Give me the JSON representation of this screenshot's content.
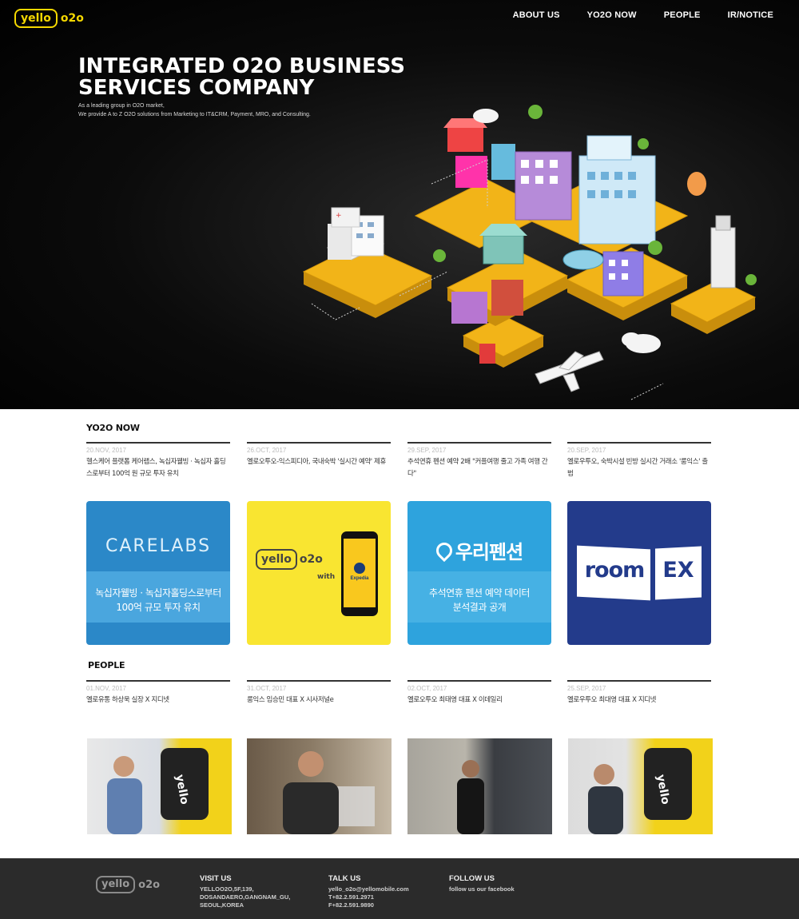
{
  "brand": {
    "logo_word": "yello",
    "logo_suffix": "o2o"
  },
  "nav": [
    {
      "label": "ABOUT US"
    },
    {
      "label": "YO2O NOW"
    },
    {
      "label": "PEOPLE"
    },
    {
      "label": "IR/NOTICE"
    }
  ],
  "hero": {
    "title_line1": "INTEGRATED O2O BUSINESS",
    "title_line2": "SERVICES COMPANY",
    "sub_line1": "As a leading group in O2O market,",
    "sub_line2": "We provide A to Z O2O solutions from Marketing to IT&CRM, Payment, MRO, and Consulting."
  },
  "yo2o_now": {
    "title": "YO2O NOW",
    "items": [
      {
        "date": "20.NOV, 2017",
        "text": "헬스케어 플랫폼 케어랩스, 녹십자웰빙 · 녹십자 홀딩스로부터 100억 원 규모 투자 유치"
      },
      {
        "date": "26.OCT, 2017",
        "text": "옐로오투오-익스피디아, 국내숙박 '실시간 예약' 제휴"
      },
      {
        "date": "29.SEP, 2017",
        "text": "추석연휴 펜션 예약 2배 \"커플여행 줄고 가족 여행 간다\""
      },
      {
        "date": "20.SEP, 2017",
        "text": "옐로우투오, 숙박시설 빈방 실시간 거래소 '룸익스' 출범"
      }
    ],
    "cards": [
      {
        "brand": "CARELABS",
        "caption_line1": "녹십자웰빙 · 녹십자홀딩스로부터",
        "caption_line2": "100억 규모 투자 유치",
        "color": "#2b88c8"
      },
      {
        "brand_word": "yello",
        "brand_suffix": "o2o",
        "with": "with",
        "partner": "Expedia",
        "color": "#f9e531"
      },
      {
        "brand": "우리펜션",
        "caption_line1": "추석연휴 펜션 예약 데이터",
        "caption_line2": "분석결과 공개",
        "color": "#2ea3dd"
      },
      {
        "brand_left": "room",
        "brand_right": "EX",
        "color": "#233b8b"
      }
    ]
  },
  "people": {
    "title": "PEOPLE",
    "items": [
      {
        "date": "01.NOV, 2017",
        "text": "옐로유통 하상욱 실장 X 지디넷"
      },
      {
        "date": "31.OCT, 2017",
        "text": "룸익스 임승민 대표 X 시사저널e"
      },
      {
        "date": "02.OCT, 2017",
        "text": "옐로오투오 최태영 대표 X 이데일리"
      },
      {
        "date": "25.SEP, 2017",
        "text": "옐로우투오 최대영 대표 X 지디넷"
      }
    ]
  },
  "footer": {
    "logo_word": "yello",
    "logo_suffix": "o2o",
    "visit_title": "VISIT US",
    "visit_lines": [
      "YELLOO2O,5F,139,",
      "DOSANDAERO,GANGNAM_GU,",
      "SEOUL,KOREA"
    ],
    "talk_title": "TALK US",
    "talk_lines": [
      "yello_o2o@yellomobile.com",
      "T+82.2.591.2971",
      "F+82.2.591.9890"
    ],
    "follow_title": "FOLLOW US",
    "follow_line": "follow us our facebook"
  }
}
